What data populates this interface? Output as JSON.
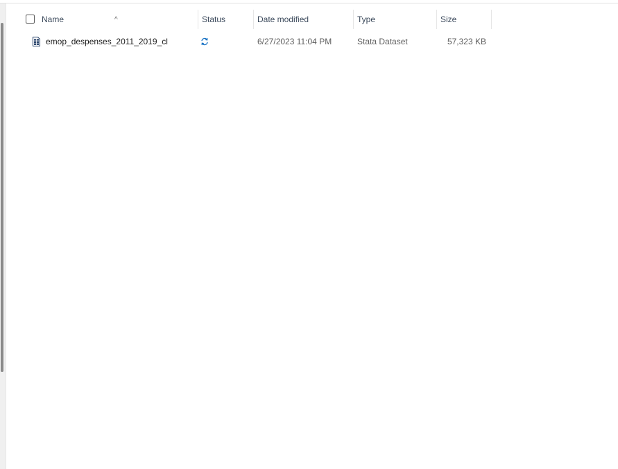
{
  "columns": {
    "name": "Name",
    "status": "Status",
    "date_modified": "Date modified",
    "type": "Type",
    "size": "Size"
  },
  "sort_indicator": "^",
  "files": [
    {
      "name": "emop_despenses_2011_2019_cl",
      "status_icon": "sync-icon",
      "date_modified": "6/27/2023 11:04 PM",
      "type": "Stata Dataset",
      "size": "57,323 KB"
    }
  ],
  "colors": {
    "header_text": "#3c4a5c",
    "sync_blue": "#1a73c4",
    "file_icon": "#1f3b63"
  }
}
